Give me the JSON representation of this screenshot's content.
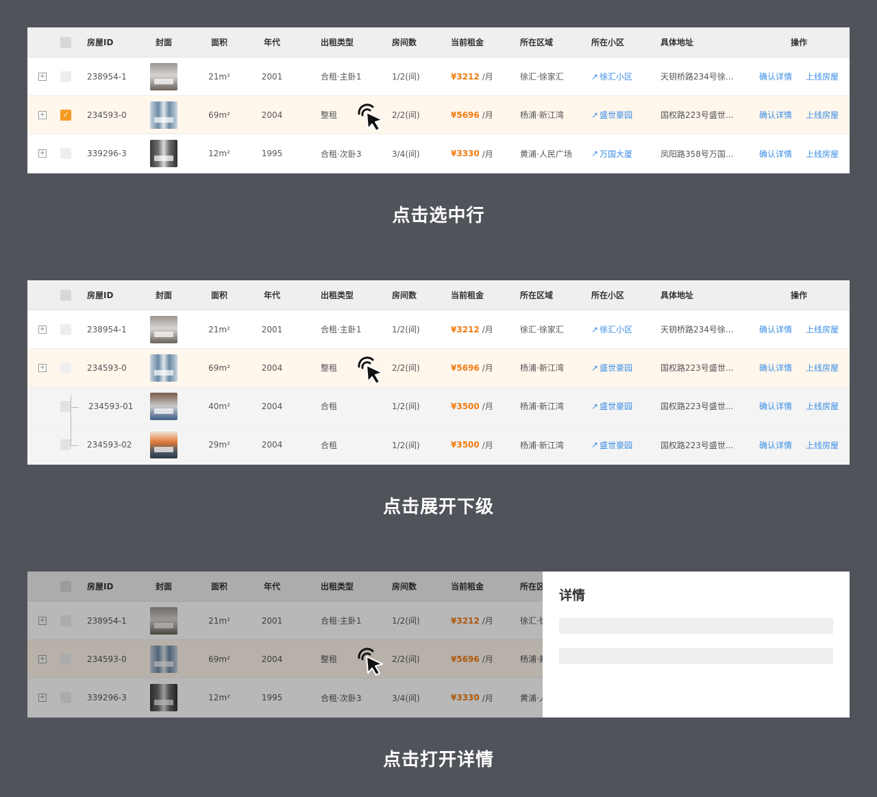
{
  "headers": {
    "id": "房屋ID",
    "cover": "封面",
    "area": "面积",
    "year": "年代",
    "rent_type": "出租类型",
    "rooms": "房间数",
    "rent": "当前租金",
    "region": "所在区域",
    "community": "所在小区",
    "address": "具体地址",
    "ops": "操作"
  },
  "actions": {
    "confirm": "确认详情",
    "online": "上线房屋"
  },
  "rent_unit": "/月",
  "rows": [
    {
      "id": "238954-1",
      "area": "21m²",
      "year": "2001",
      "rent_type": "合租·主卧1",
      "rooms": "1/2(间)",
      "rent": "¥3212",
      "region": "徐汇·徐家汇",
      "community": "徐汇小区",
      "address": "天钥桥路234号徐..."
    },
    {
      "id": "234593-0",
      "area": "69m²",
      "year": "2004",
      "rent_type": "整租",
      "rooms": "2/2(间)",
      "rent": "¥5696",
      "region": "杨浦·新江湾",
      "community": "盛世豪园",
      "address": "国权路223号盛世..."
    },
    {
      "id": "339296-3",
      "area": "12m²",
      "year": "1995",
      "rent_type": "合租·次卧3",
      "rooms": "3/4(间)",
      "rent": "¥3330",
      "region": "黄浦·人民广场",
      "community": "万国大厦",
      "address": "凤阳路358号万国..."
    }
  ],
  "children": [
    {
      "id": "234593-01",
      "area": "40m²",
      "year": "2004",
      "rent_type": "合租",
      "rooms": "1/2(间)",
      "rent": "¥3500",
      "region": "杨浦·新江湾",
      "community": "盛世豪园",
      "address": "国权路223号盛世..."
    },
    {
      "id": "234593-02",
      "area": "29m²",
      "year": "2004",
      "rent_type": "合租",
      "rooms": "1/2(间)",
      "rent": "¥3500",
      "region": "杨浦·新江湾",
      "community": "盛世豪园",
      "address": "国权路223号盛世..."
    }
  ],
  "panel3_regions": [
    "徐汇·徐",
    "杨浦·新",
    "黄浦·人"
  ],
  "captions": {
    "select_row": "点击选中行",
    "expand": "点击展开下级",
    "open_detail": "点击打开详情"
  },
  "drawer": {
    "title": "详情"
  },
  "icons": {
    "expand": "plus-square-icon",
    "check": "checkmark-icon",
    "link": "arrow-up-right-icon",
    "cursor": "pointer-click-icon"
  },
  "colors": {
    "background": "#505359",
    "accent_rent": "#f07b10",
    "link": "#3a8ee6",
    "selected_row": "#fff6ec",
    "checkbox_checked": "#f59a23"
  }
}
